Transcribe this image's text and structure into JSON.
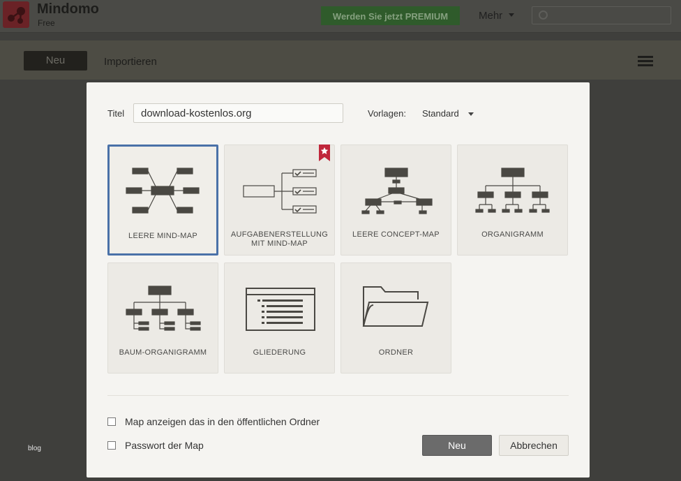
{
  "app": {
    "name": "Mindomo",
    "edition": "Free"
  },
  "topbar": {
    "premium_label": "Werden Sie jetzt PREMIUM",
    "more_label": "Mehr",
    "search_placeholder": ""
  },
  "toolbar": {
    "new_label": "Neu",
    "import_label": "Importieren"
  },
  "footer": {
    "blog_label": "blog"
  },
  "dialog": {
    "title_label": "Titel",
    "title_value": "download-kostenlos.org",
    "templates_label": "Vorlagen:",
    "templates_value": "Standard",
    "tiles": [
      {
        "label": "LEERE MIND-MAP",
        "selected": true
      },
      {
        "label": "AUFGABENERSTELLUNG",
        "label2": "MIT MIND-MAP",
        "premium": true
      },
      {
        "label": "LEERE CONCEPT-MAP"
      },
      {
        "label": "ORGANIGRAMM"
      },
      {
        "label": "BAUM-ORGANIGRAMM"
      },
      {
        "label": "GLIEDERUNG"
      },
      {
        "label": "ORDNER"
      }
    ],
    "public_checkbox_label": "Map anzeigen das in den öffentlichen Ordner",
    "password_checkbox_label": "Passwort der Map",
    "ok_label": "Neu",
    "cancel_label": "Abbrechen"
  },
  "colors": {
    "selected_border": "#4a71a8",
    "premium_badge": "#c0273b",
    "icon": "#4a4843"
  }
}
